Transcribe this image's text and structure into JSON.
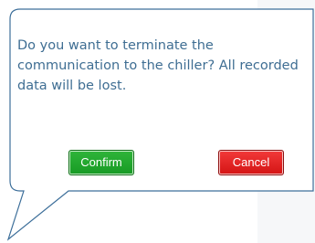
{
  "dialog": {
    "message": "Do you want to terminate the communication to the chiller? All recorded data will be lost.",
    "confirm_label": "Confirm",
    "cancel_label": "Cancel"
  },
  "colors": {
    "text": "#3f6e93",
    "border": "#3d6f9a",
    "confirm": "#1fa52c",
    "cancel": "#e02020"
  }
}
